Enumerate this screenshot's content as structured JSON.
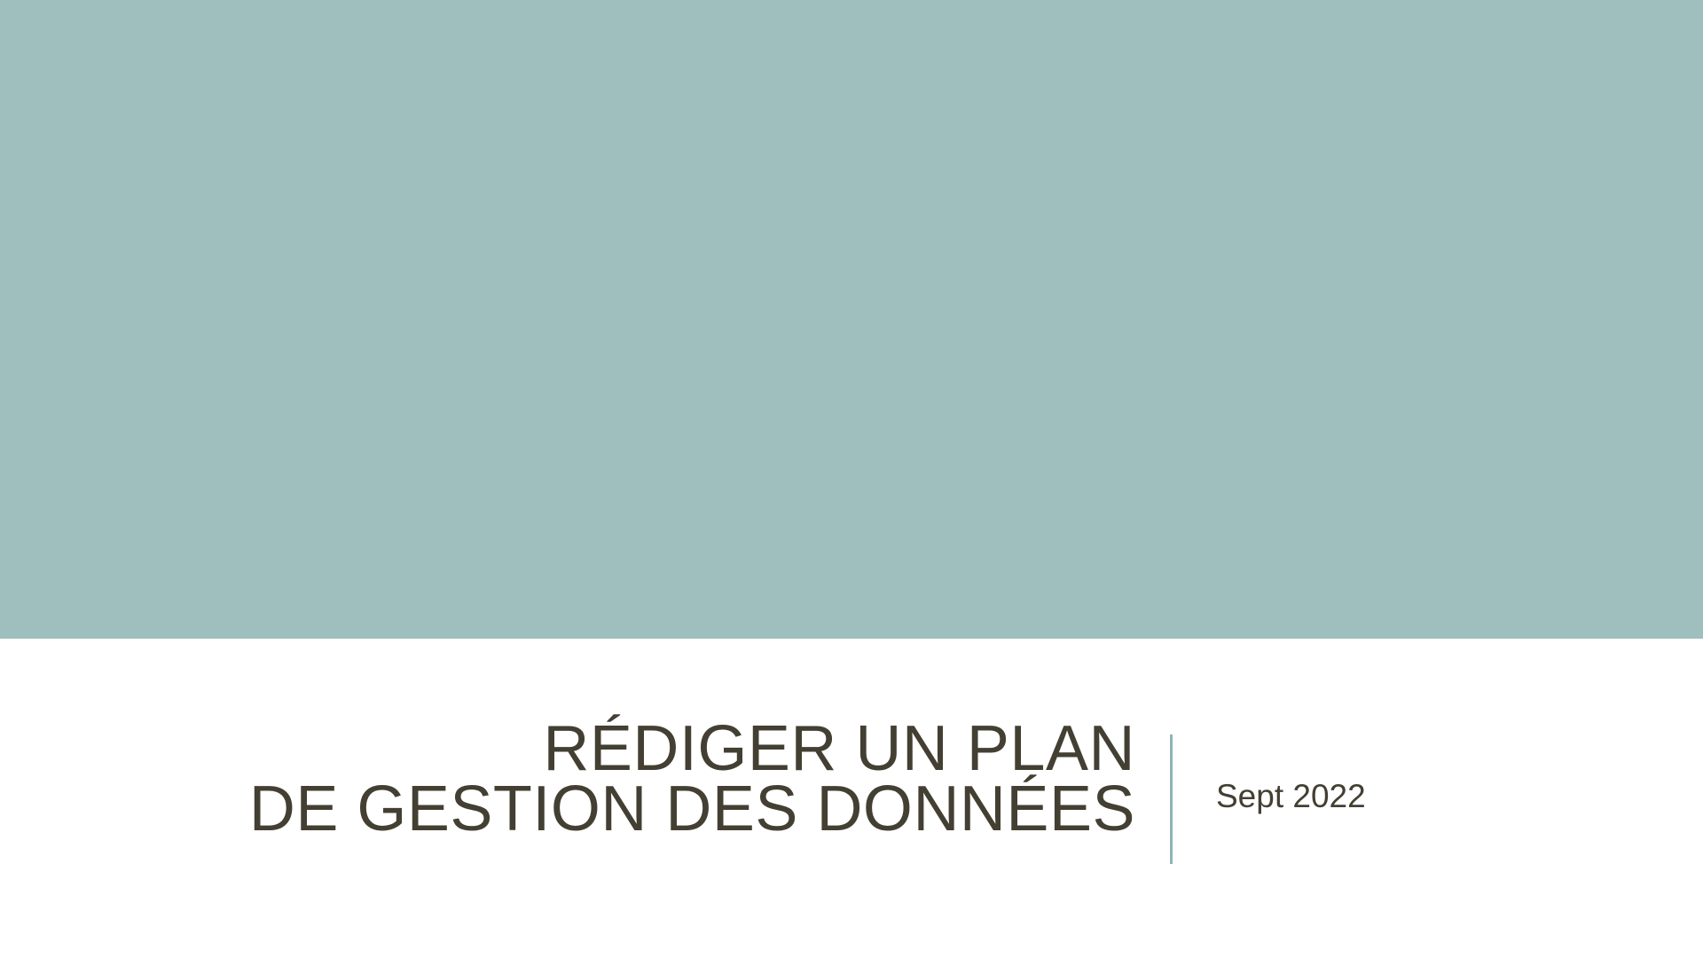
{
  "slide": {
    "title_lines": [
      "RÉDIGER UN PLAN",
      "DE GESTION DES DONNÉES"
    ],
    "subtitle": "Sept 2022"
  },
  "colors": {
    "band": "#9EBFBE",
    "text": "#433F32",
    "divider": "#8FB3BC",
    "background": "#FFFFFF"
  }
}
